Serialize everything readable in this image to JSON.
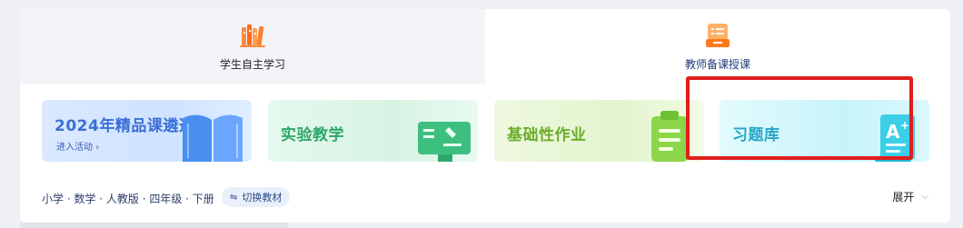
{
  "tabs": [
    {
      "label": "学生自主学习",
      "icon": "bookshelf-icon"
    },
    {
      "label": "教师备课授课",
      "icon": "teaching-board-icon"
    }
  ],
  "cards": [
    {
      "title": "2024年精品课遴选",
      "subtitle": "进入活动 ›",
      "icon": "open-book-icon"
    },
    {
      "title": "实验教学",
      "icon": "microscope-board-icon"
    },
    {
      "title": "基础性作业",
      "icon": "clipboard-icon"
    },
    {
      "title": "习题库",
      "icon": "grade-sheet-icon"
    }
  ],
  "footer": {
    "path": "小学 · 数学 · 人教版 · 四年级 · 下册",
    "switch_label": "切换教材",
    "switch_icon": "⇋",
    "expand_label": "展开",
    "expand_icon": "⌵"
  },
  "colors": {
    "highlight": "#e21d1d",
    "accent_blue": "#3b6fd6",
    "accent_green": "#2ea86a",
    "accent_lime": "#6cad2b",
    "accent_cyan": "#27a6c7"
  }
}
